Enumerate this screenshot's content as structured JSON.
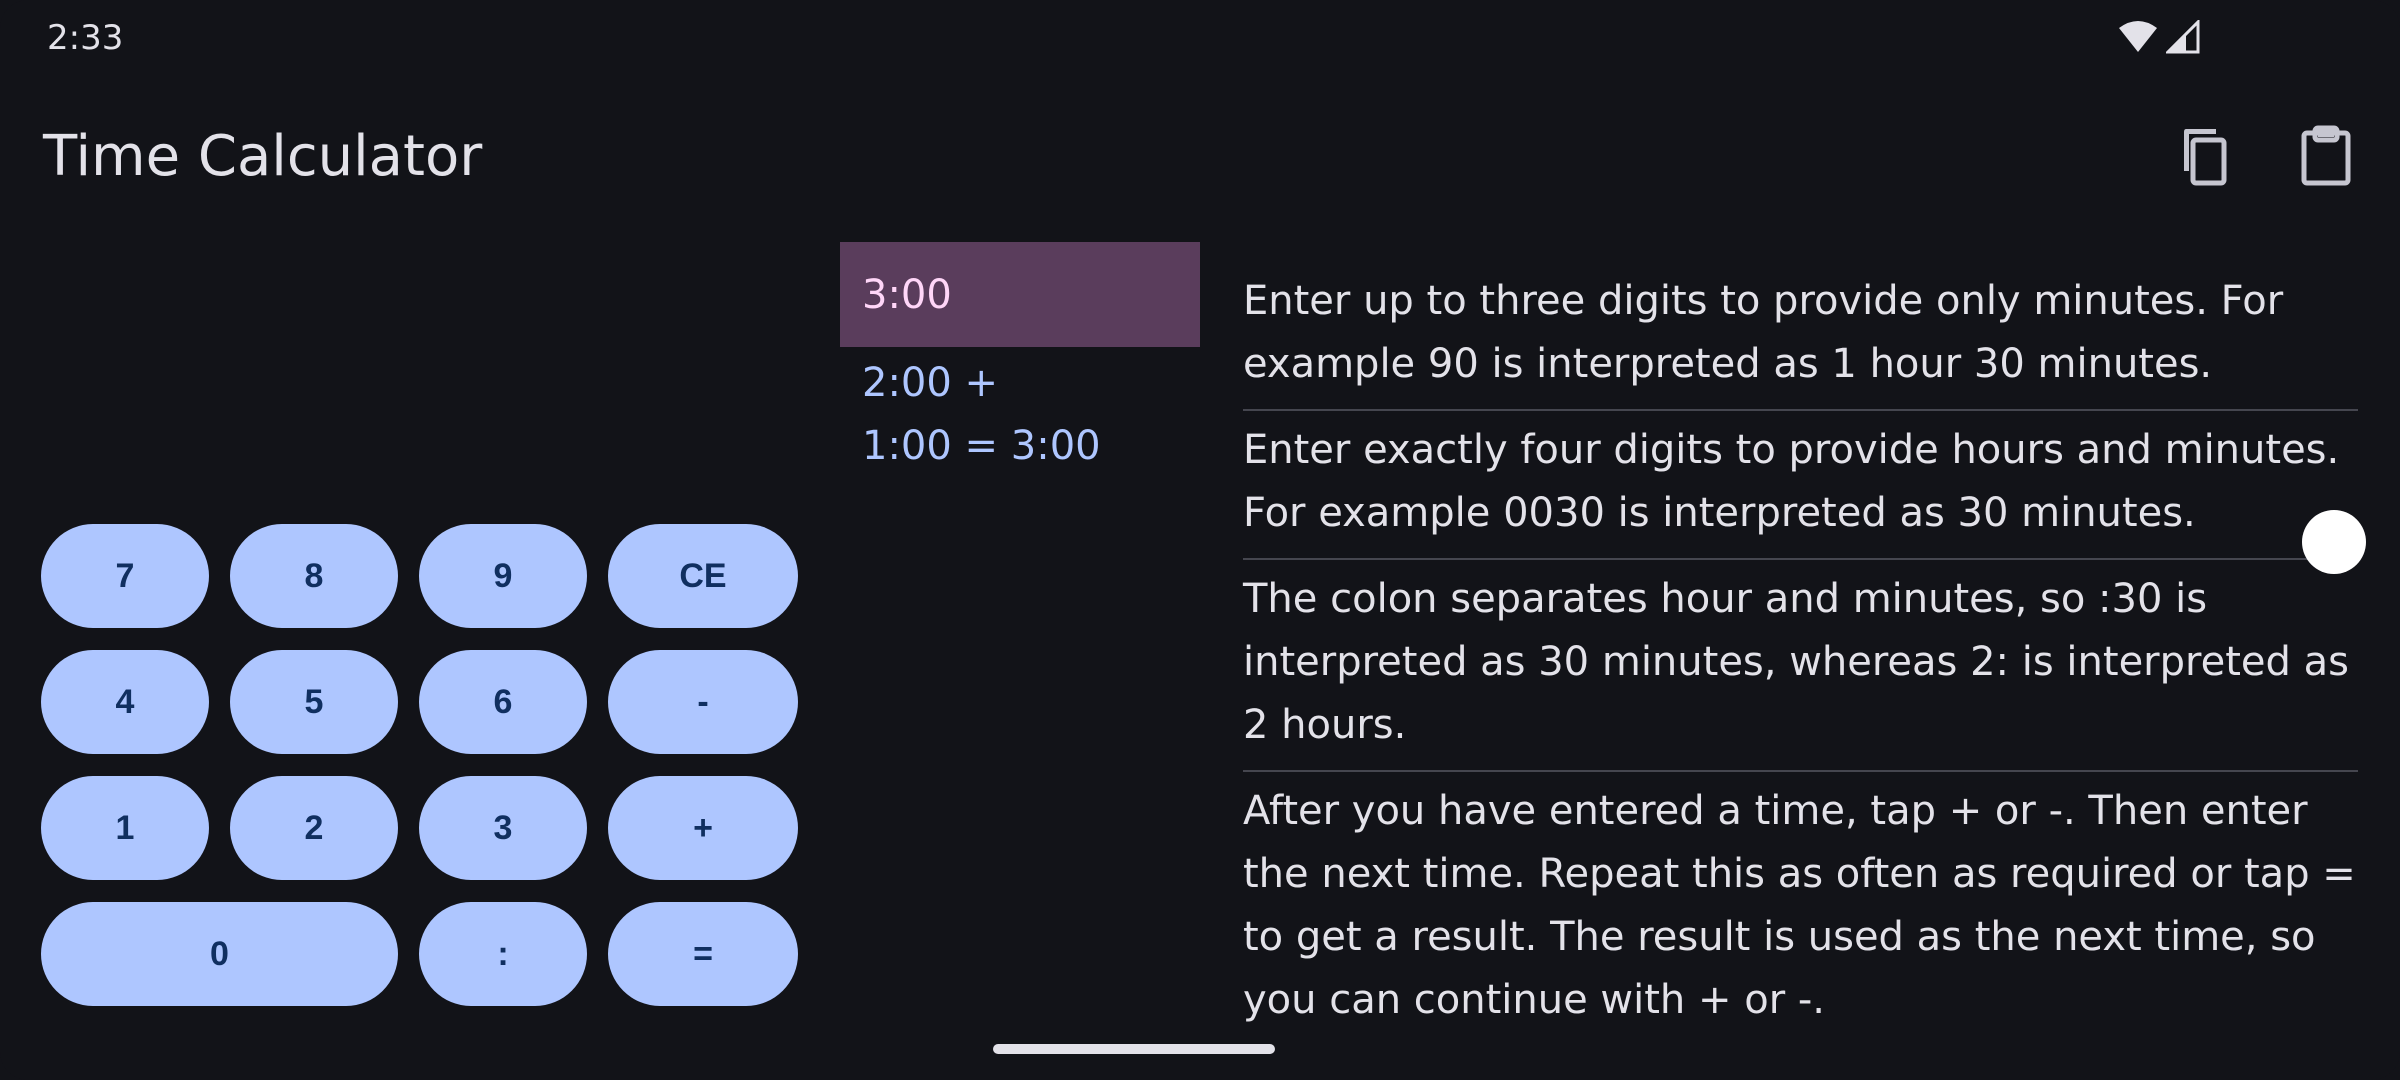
{
  "status_bar": {
    "time": "2:33",
    "icons": [
      "wifi-icon",
      "cellular-signal-icon"
    ]
  },
  "app_bar": {
    "title": "Time Calculator",
    "actions": [
      "copy-icon",
      "paste-clipboard-icon"
    ]
  },
  "display": {
    "current": "3:00",
    "history": [
      "2:00 +",
      "1:00 = 3:00"
    ]
  },
  "keypad": {
    "rows": [
      [
        "7",
        "8",
        "9",
        "CE"
      ],
      [
        "4",
        "5",
        "6",
        "-"
      ],
      [
        "1",
        "2",
        "3",
        "+"
      ],
      [
        "0",
        ":",
        "="
      ]
    ]
  },
  "help": [
    "Enter up to three digits to provide only minutes. For example 90 is interpreted as 1 hour 30 minutes.",
    "Enter exactly four digits to provide hours and minutes. For example 0030 is interpreted as 30 minutes.",
    "The colon separates hour and minutes, so :30 is interpreted as 30 minutes, whereas 2: is interpreted as 2 hours.",
    "After you have entered a time, tap + or -. Then enter the next time. Repeat this as often as required or tap = to get a result. The result is used as the next time, so you can continue with + or -."
  ],
  "colors": {
    "background": "#121318",
    "key_bg": "#aec6ff",
    "key_text": "#102f60",
    "current_bg": "#5a3d5c",
    "current_text": "#ffd6f8",
    "history_text": "#aec6ff"
  }
}
